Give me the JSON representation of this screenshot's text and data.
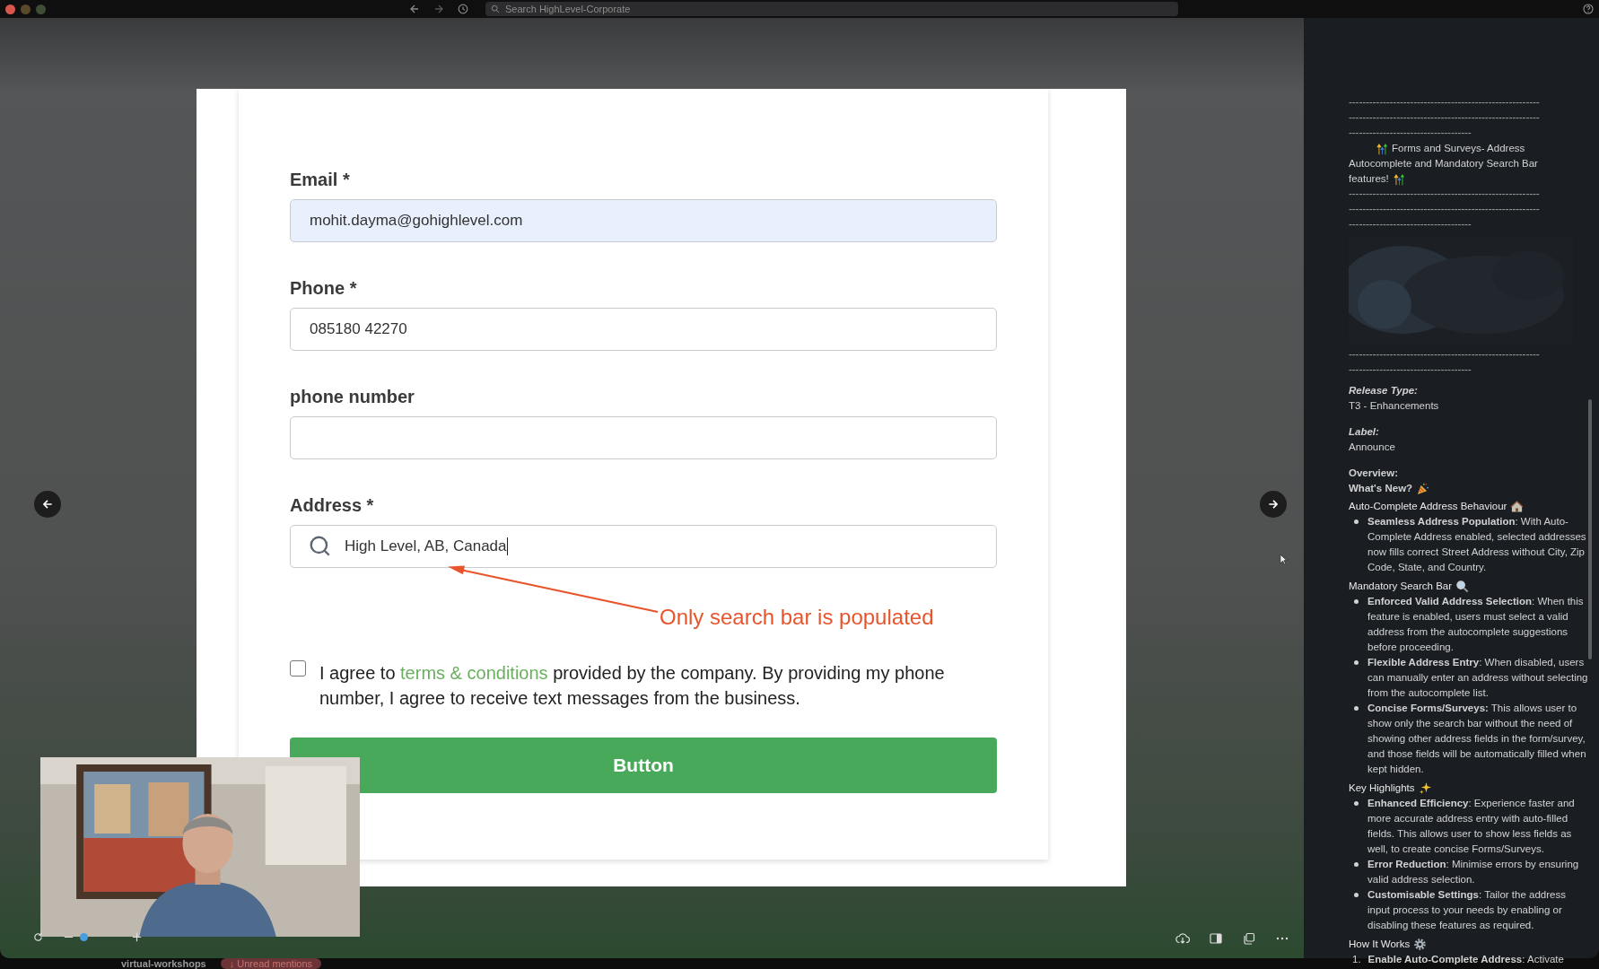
{
  "top_bar": {
    "search_placeholder": "Search HighLevel-Corporate"
  },
  "form": {
    "fields": [
      {
        "label": "Email *",
        "value": "mohit.dayma@gohighlevel.com",
        "kind": "text",
        "autofilled": true
      },
      {
        "label": "Phone *",
        "value": "085180 42270",
        "kind": "text",
        "autofilled": false
      },
      {
        "label": "phone number",
        "kind": "text",
        "autofilled": false
      },
      {
        "label": "Address *",
        "value": "High Level, AB, Canada",
        "kind": "search",
        "autofilled": false
      }
    ],
    "annotation": "Only search bar is populated",
    "consent": {
      "checked": false,
      "before": "I agree to ",
      "link": "terms & conditions",
      "after": " provided by the company. By providing my phone number, I agree to receive text messages from the business."
    },
    "submit": "Button"
  },
  "channel_bar": {
    "channel": "virtual-workshops",
    "badge": "↓ Unread mentions"
  },
  "post": {
    "dashes_top": [
      "--------------------------------------------------------",
      "--------------------------------------------------------",
      "------------------------------------"
    ],
    "title_lines": [
      "Forms and Surveys- Address",
      "Autocomplete and Mandatory Search Bar",
      "features!"
    ],
    "dashes_mid": [
      "--------------------------------------------------------",
      "--------------------------------------------------------",
      "------------------------------------"
    ],
    "dashes_bottom": [
      "--------------------------------------------------------",
      "------------------------------------"
    ],
    "fields": [
      {
        "label": "Release Type:",
        "value": "T3 - Enhancements"
      },
      {
        "label": "Label:",
        "value": "Announce"
      }
    ],
    "overview": "Overview:",
    "whats_new": "What's New?",
    "sections": [
      {
        "heading": "Auto-Complete Address Behaviour",
        "items": [
          "**Seamless Address Population**: With Auto-Complete Address enabled, selected addresses now fills correct Street Address without City, Zip Code, State, and Country."
        ]
      },
      {
        "heading": "Mandatory Search Bar",
        "items": [
          "**Enforced Valid Address Selection**: When this feature is enabled, users must select a valid address from the autocomplete suggestions before proceeding.",
          "**Flexible Address Entry**: When disabled, users can manually enter an address without selecting from the autocomplete list.",
          "**Concise Forms/Surveys:** This allows user to show only the search bar without the need of showing other address fields in the form/survey, and those fields will be automatically filled when kept hidden."
        ]
      },
      {
        "heading": "Key Highlights",
        "items": [
          "**Enhanced Efficiency**: Experience faster and more accurate address entry with auto-filled fields. This allows user to show less fields as well, to create concise Forms/Surveys.",
          "**Error Reduction**: Minimise errors by ensuring valid address selection.",
          "**Customisable Settings**: Tailor the address input process to your needs by enabling or disabling these features as required."
        ]
      }
    ],
    "how": {
      "heading": "How It Works",
      "steps": [
        {
          "number": "1.",
          "text": "**Enable Auto-Complete Address**: Activate"
        }
      ]
    }
  }
}
